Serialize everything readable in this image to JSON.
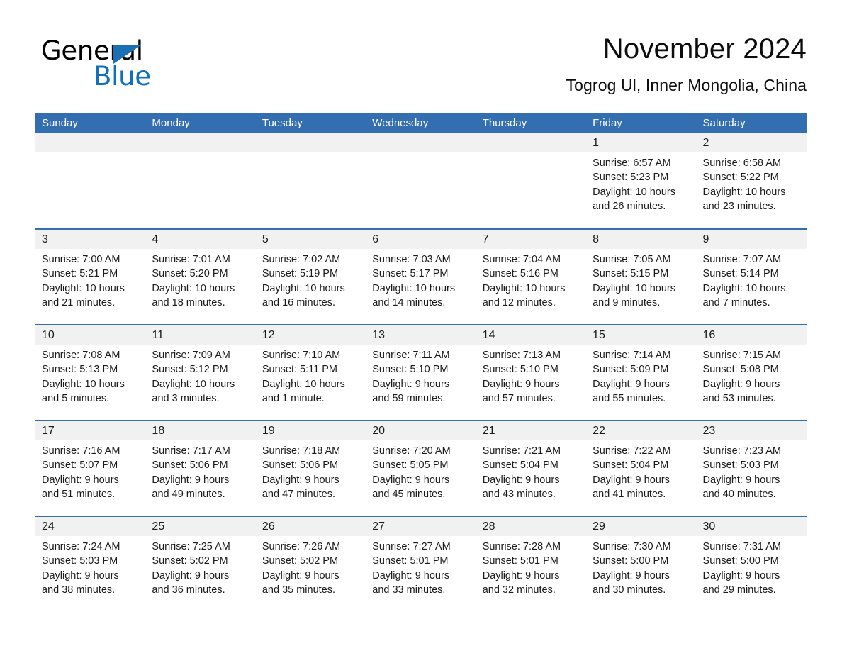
{
  "brand": {
    "name_part1": "General",
    "name_part2": "Blue",
    "triangle_color": "#1a6fb5",
    "blue_color": "#1070bd"
  },
  "header": {
    "title": "November 2024",
    "subtitle": "Togrog Ul, Inner Mongolia, China"
  },
  "theme": {
    "header_blue": "#336fb0",
    "day_band_gray": "#f1f1f1",
    "text_color": "#1a1a1a"
  },
  "weekdays": [
    "Sunday",
    "Monday",
    "Tuesday",
    "Wednesday",
    "Thursday",
    "Friday",
    "Saturday"
  ],
  "weeks": [
    [
      {
        "day": "",
        "sunrise": "",
        "sunset": "",
        "daylight1": "",
        "daylight2": ""
      },
      {
        "day": "",
        "sunrise": "",
        "sunset": "",
        "daylight1": "",
        "daylight2": ""
      },
      {
        "day": "",
        "sunrise": "",
        "sunset": "",
        "daylight1": "",
        "daylight2": ""
      },
      {
        "day": "",
        "sunrise": "",
        "sunset": "",
        "daylight1": "",
        "daylight2": ""
      },
      {
        "day": "",
        "sunrise": "",
        "sunset": "",
        "daylight1": "",
        "daylight2": ""
      },
      {
        "day": "1",
        "sunrise": "Sunrise: 6:57 AM",
        "sunset": "Sunset: 5:23 PM",
        "daylight1": "Daylight: 10 hours",
        "daylight2": "and 26 minutes."
      },
      {
        "day": "2",
        "sunrise": "Sunrise: 6:58 AM",
        "sunset": "Sunset: 5:22 PM",
        "daylight1": "Daylight: 10 hours",
        "daylight2": "and 23 minutes."
      }
    ],
    [
      {
        "day": "3",
        "sunrise": "Sunrise: 7:00 AM",
        "sunset": "Sunset: 5:21 PM",
        "daylight1": "Daylight: 10 hours",
        "daylight2": "and 21 minutes."
      },
      {
        "day": "4",
        "sunrise": "Sunrise: 7:01 AM",
        "sunset": "Sunset: 5:20 PM",
        "daylight1": "Daylight: 10 hours",
        "daylight2": "and 18 minutes."
      },
      {
        "day": "5",
        "sunrise": "Sunrise: 7:02 AM",
        "sunset": "Sunset: 5:19 PM",
        "daylight1": "Daylight: 10 hours",
        "daylight2": "and 16 minutes."
      },
      {
        "day": "6",
        "sunrise": "Sunrise: 7:03 AM",
        "sunset": "Sunset: 5:17 PM",
        "daylight1": "Daylight: 10 hours",
        "daylight2": "and 14 minutes."
      },
      {
        "day": "7",
        "sunrise": "Sunrise: 7:04 AM",
        "sunset": "Sunset: 5:16 PM",
        "daylight1": "Daylight: 10 hours",
        "daylight2": "and 12 minutes."
      },
      {
        "day": "8",
        "sunrise": "Sunrise: 7:05 AM",
        "sunset": "Sunset: 5:15 PM",
        "daylight1": "Daylight: 10 hours",
        "daylight2": "and 9 minutes."
      },
      {
        "day": "9",
        "sunrise": "Sunrise: 7:07 AM",
        "sunset": "Sunset: 5:14 PM",
        "daylight1": "Daylight: 10 hours",
        "daylight2": "and 7 minutes."
      }
    ],
    [
      {
        "day": "10",
        "sunrise": "Sunrise: 7:08 AM",
        "sunset": "Sunset: 5:13 PM",
        "daylight1": "Daylight: 10 hours",
        "daylight2": "and 5 minutes."
      },
      {
        "day": "11",
        "sunrise": "Sunrise: 7:09 AM",
        "sunset": "Sunset: 5:12 PM",
        "daylight1": "Daylight: 10 hours",
        "daylight2": "and 3 minutes."
      },
      {
        "day": "12",
        "sunrise": "Sunrise: 7:10 AM",
        "sunset": "Sunset: 5:11 PM",
        "daylight1": "Daylight: 10 hours",
        "daylight2": "and 1 minute."
      },
      {
        "day": "13",
        "sunrise": "Sunrise: 7:11 AM",
        "sunset": "Sunset: 5:10 PM",
        "daylight1": "Daylight: 9 hours",
        "daylight2": "and 59 minutes."
      },
      {
        "day": "14",
        "sunrise": "Sunrise: 7:13 AM",
        "sunset": "Sunset: 5:10 PM",
        "daylight1": "Daylight: 9 hours",
        "daylight2": "and 57 minutes."
      },
      {
        "day": "15",
        "sunrise": "Sunrise: 7:14 AM",
        "sunset": "Sunset: 5:09 PM",
        "daylight1": "Daylight: 9 hours",
        "daylight2": "and 55 minutes."
      },
      {
        "day": "16",
        "sunrise": "Sunrise: 7:15 AM",
        "sunset": "Sunset: 5:08 PM",
        "daylight1": "Daylight: 9 hours",
        "daylight2": "and 53 minutes."
      }
    ],
    [
      {
        "day": "17",
        "sunrise": "Sunrise: 7:16 AM",
        "sunset": "Sunset: 5:07 PM",
        "daylight1": "Daylight: 9 hours",
        "daylight2": "and 51 minutes."
      },
      {
        "day": "18",
        "sunrise": "Sunrise: 7:17 AM",
        "sunset": "Sunset: 5:06 PM",
        "daylight1": "Daylight: 9 hours",
        "daylight2": "and 49 minutes."
      },
      {
        "day": "19",
        "sunrise": "Sunrise: 7:18 AM",
        "sunset": "Sunset: 5:06 PM",
        "daylight1": "Daylight: 9 hours",
        "daylight2": "and 47 minutes."
      },
      {
        "day": "20",
        "sunrise": "Sunrise: 7:20 AM",
        "sunset": "Sunset: 5:05 PM",
        "daylight1": "Daylight: 9 hours",
        "daylight2": "and 45 minutes."
      },
      {
        "day": "21",
        "sunrise": "Sunrise: 7:21 AM",
        "sunset": "Sunset: 5:04 PM",
        "daylight1": "Daylight: 9 hours",
        "daylight2": "and 43 minutes."
      },
      {
        "day": "22",
        "sunrise": "Sunrise: 7:22 AM",
        "sunset": "Sunset: 5:04 PM",
        "daylight1": "Daylight: 9 hours",
        "daylight2": "and 41 minutes."
      },
      {
        "day": "23",
        "sunrise": "Sunrise: 7:23 AM",
        "sunset": "Sunset: 5:03 PM",
        "daylight1": "Daylight: 9 hours",
        "daylight2": "and 40 minutes."
      }
    ],
    [
      {
        "day": "24",
        "sunrise": "Sunrise: 7:24 AM",
        "sunset": "Sunset: 5:03 PM",
        "daylight1": "Daylight: 9 hours",
        "daylight2": "and 38 minutes."
      },
      {
        "day": "25",
        "sunrise": "Sunrise: 7:25 AM",
        "sunset": "Sunset: 5:02 PM",
        "daylight1": "Daylight: 9 hours",
        "daylight2": "and 36 minutes."
      },
      {
        "day": "26",
        "sunrise": "Sunrise: 7:26 AM",
        "sunset": "Sunset: 5:02 PM",
        "daylight1": "Daylight: 9 hours",
        "daylight2": "and 35 minutes."
      },
      {
        "day": "27",
        "sunrise": "Sunrise: 7:27 AM",
        "sunset": "Sunset: 5:01 PM",
        "daylight1": "Daylight: 9 hours",
        "daylight2": "and 33 minutes."
      },
      {
        "day": "28",
        "sunrise": "Sunrise: 7:28 AM",
        "sunset": "Sunset: 5:01 PM",
        "daylight1": "Daylight: 9 hours",
        "daylight2": "and 32 minutes."
      },
      {
        "day": "29",
        "sunrise": "Sunrise: 7:30 AM",
        "sunset": "Sunset: 5:00 PM",
        "daylight1": "Daylight: 9 hours",
        "daylight2": "and 30 minutes."
      },
      {
        "day": "30",
        "sunrise": "Sunrise: 7:31 AM",
        "sunset": "Sunset: 5:00 PM",
        "daylight1": "Daylight: 9 hours",
        "daylight2": "and 29 minutes."
      }
    ]
  ]
}
